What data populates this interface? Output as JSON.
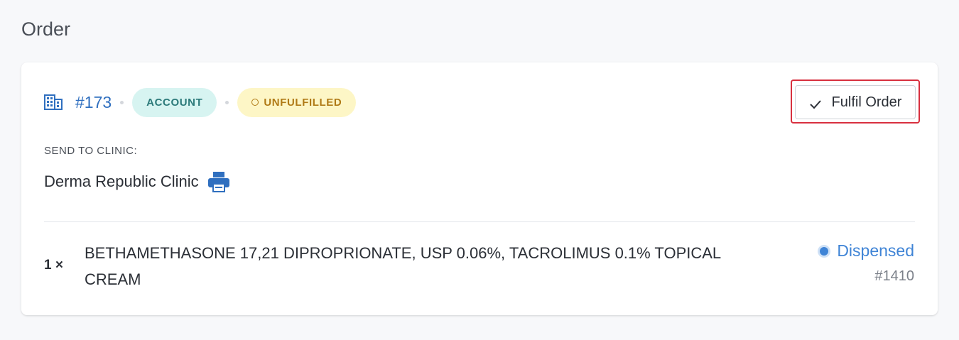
{
  "page": {
    "title": "Order"
  },
  "order": {
    "number": "#173",
    "badges": {
      "account": "ACCOUNT",
      "unfulfilled": "UNFULFILLED"
    },
    "fulfil_label": "Fulfil Order",
    "send_to_label": "SEND TO CLINIC:",
    "clinic_name": "Derma Republic Clinic",
    "items": [
      {
        "quantity": "1 ×",
        "name": "BETHAMETHASONE 17,21 DIPROPRIONATE, USP 0.06%, TACROLIMUS 0.1% TOPICAL CREAM",
        "status": "Dispensed",
        "ref": "#1410"
      }
    ]
  },
  "icons": {
    "building": "building-icon",
    "circle": "circle-outline-icon",
    "check": "check-icon",
    "printer": "printer-icon",
    "status": "radio-dot-icon"
  },
  "colors": {
    "accent_blue": "#2f6fbf",
    "status_blue": "#3f84d6",
    "account_bg": "#d7f4f1",
    "account_fg": "#2c7a7a",
    "unfulfilled_bg": "#fdf6c6",
    "unfulfilled_fg": "#b07a16",
    "highlight_red": "#d8303f"
  }
}
